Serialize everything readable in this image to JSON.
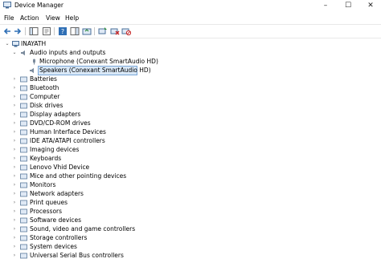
{
  "window": {
    "title": "Device Manager",
    "controls": {
      "minimize": "–",
      "maximize": "☐",
      "close": "✕"
    }
  },
  "menu": [
    "File",
    "Action",
    "View",
    "Help"
  ],
  "toolbar": {
    "buttons": [
      "back-arrow-icon",
      "forward-arrow-icon",
      "show-hide-console-tree-icon",
      "properties-icon",
      "help-icon",
      "show-action-pane-icon",
      "update-driver-icon",
      "uninstall-device-icon",
      "scan-hardware-changes-icon"
    ]
  },
  "tree": {
    "root": "INAYATH",
    "audio": {
      "label": "Audio inputs and outputs",
      "children": [
        "Microphone (Conexant SmartAudio HD)",
        "Speakers (Conexant SmartAudio HD)"
      ],
      "selected_index": 1
    },
    "categories": [
      "Batteries",
      "Bluetooth",
      "Computer",
      "Disk drives",
      "Display adapters",
      "DVD/CD-ROM drives",
      "Human Interface Devices",
      "IDE ATA/ATAPI controllers",
      "Imaging devices",
      "Keyboards",
      "Lenovo Vhid Device",
      "Mice and other pointing devices",
      "Monitors",
      "Network adapters",
      "Print queues",
      "Processors",
      "Software devices",
      "Sound, video and game controllers",
      "Storage controllers",
      "System devices",
      "Universal Serial Bus controllers"
    ],
    "category_icons": [
      "battery-icon",
      "bluetooth-icon",
      "computer-icon",
      "disk-drive-icon",
      "display-adapter-icon",
      "dvd-drive-icon",
      "hid-icon",
      "ide-controller-icon",
      "camera-icon",
      "keyboard-icon",
      "device-icon",
      "mouse-icon",
      "monitor-icon",
      "network-adapter-icon",
      "printer-icon",
      "processor-icon",
      "software-device-icon",
      "speaker-icon",
      "storage-controller-icon",
      "system-device-icon",
      "usb-icon"
    ]
  },
  "colors": {
    "selection_fill": "#d9e8f7",
    "selection_border": "#7aa7d8"
  }
}
